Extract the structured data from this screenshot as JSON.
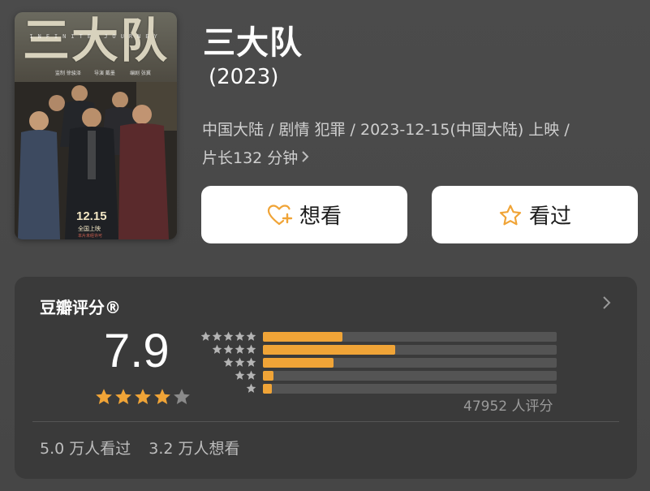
{
  "movie": {
    "title": "三大队",
    "year": "(2023)",
    "meta_line1": "中国大陆 / 剧情 犯罪 / 2023-12-15(中国大陆) 上映 /",
    "meta_line2": "片长132 分钟"
  },
  "poster": {
    "title": "三大队",
    "subtitle": "INFINITE JOURNEY",
    "credit_a": "监制 徐骏泽",
    "credit_b": "导演 戴墨",
    "credit_c": "编剧 张冀",
    "date": "12.15",
    "release": "全国上映",
    "fine": "本片未经许可"
  },
  "buttons": {
    "want_label": "想看",
    "seen_label": "看过",
    "want_icon": "heart-plus-icon",
    "seen_icon": "star-outline-icon"
  },
  "rating": {
    "heading": "豆瓣评分®",
    "score": "7.9",
    "stars_filled": 4,
    "stars_total": 5,
    "distribution": [
      {
        "stars": 5,
        "fraction": 0.27
      },
      {
        "stars": 4,
        "fraction": 0.45
      },
      {
        "stars": 3,
        "fraction": 0.24
      },
      {
        "stars": 2,
        "fraction": 0.035
      },
      {
        "stars": 1,
        "fraction": 0.03
      }
    ],
    "count_text": "47952 人评分",
    "seen_text": "5.0 万人看过",
    "want_text": "3.2 万人想看"
  },
  "colors": {
    "accent": "#f0a437",
    "card_bg": "#3a3a3a",
    "page_bg": "#484848"
  }
}
